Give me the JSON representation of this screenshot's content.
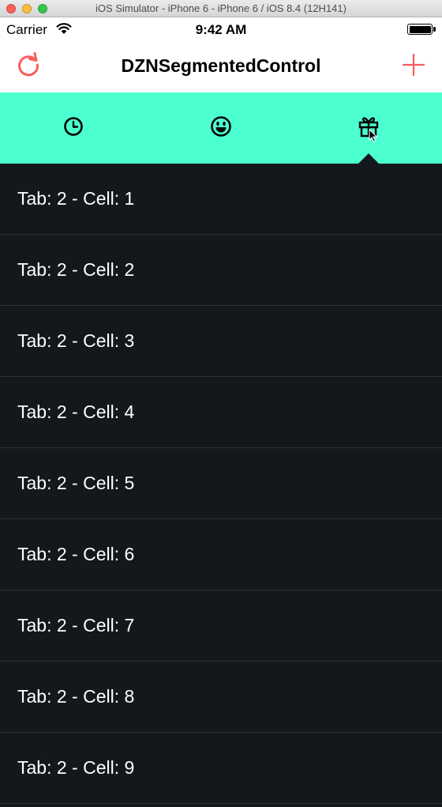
{
  "window": {
    "title": "iOS Simulator - iPhone 6 - iPhone 6 / iOS 8.4 (12H141)"
  },
  "statusbar": {
    "carrier": "Carrier",
    "time": "9:42 AM"
  },
  "navbar": {
    "title": "DZNSegmentedControl",
    "left_icon": "refresh-icon",
    "right_icon": "plus-icon",
    "accent_color": "#fa5d5d"
  },
  "segmented": {
    "background": "#4cffd0",
    "selected_index": 2,
    "segments": [
      {
        "icon": "clock-icon"
      },
      {
        "icon": "smiley-icon"
      },
      {
        "icon": "gift-icon"
      }
    ]
  },
  "table": {
    "background": "#14181c",
    "cells": [
      "Tab: 2 - Cell: 1",
      "Tab: 2 - Cell: 2",
      "Tab: 2 - Cell: 3",
      "Tab: 2 - Cell: 4",
      "Tab: 2 - Cell: 5",
      "Tab: 2 - Cell: 6",
      "Tab: 2 - Cell: 7",
      "Tab: 2 - Cell: 8",
      "Tab: 2 - Cell: 9"
    ]
  }
}
